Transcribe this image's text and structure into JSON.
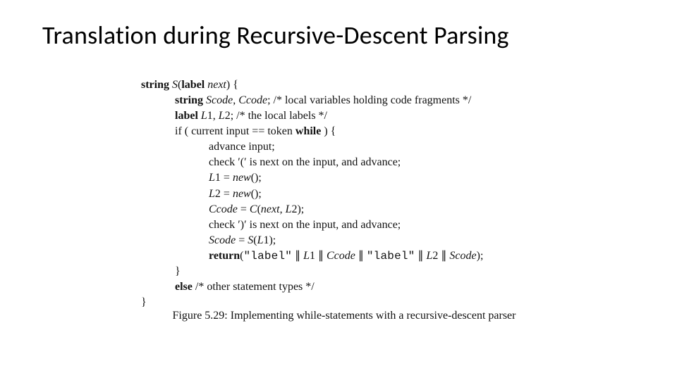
{
  "title": "Translation during Recursive-Descent Parsing",
  "code": {
    "l1_a": "string",
    "l1_b": " S",
    "l1_c": "(",
    "l1_d": "label",
    "l1_e": " next",
    "l1_f": ") {",
    "l2_a": "string",
    "l2_b": " Scode",
    "l2_c": ", ",
    "l2_d": "Ccode",
    "l2_e": "; /* local variables holding code fragments */",
    "l3_a": "label",
    "l3_b": " L",
    "l3_c": "1, ",
    "l3_d": "L",
    "l3_e": "2; /* the local labels */",
    "l4_a": "if ( current input == token ",
    "l4_b": "while",
    "l4_c": " ) {",
    "l5": "advance input;",
    "l6": "check ′(′ is next on the input, and advance;",
    "l7_a": "L",
    "l7_b": "1 = ",
    "l7_c": "new",
    "l7_d": "();",
    "l8_a": "L",
    "l8_b": "2 = ",
    "l8_c": "new",
    "l8_d": "();",
    "l9_a": "Ccode",
    "l9_b": " = ",
    "l9_c": "C",
    "l9_d": "(",
    "l9_e": "next",
    "l9_f": ", ",
    "l9_g": "L",
    "l9_h": "2);",
    "l10": "check ′)′ is next on the input, and advance;",
    "l11_a": "Scode",
    "l11_b": " = ",
    "l11_c": "S",
    "l11_d": "(",
    "l11_e": "L",
    "l11_f": "1);",
    "l12_a": "return",
    "l12_b": "(",
    "l12_c": "\"label\"",
    "l12_d": " ∥ ",
    "l12_e": "L",
    "l12_f": "1 ∥ ",
    "l12_g": "Ccode",
    "l12_h": " ∥ ",
    "l12_i": "\"label\"",
    "l12_j": " ∥ ",
    "l12_k": "L",
    "l12_l": "2 ∥ ",
    "l12_m": "Scode",
    "l12_n": ");",
    "l13": "}",
    "l14_a": "else",
    "l14_b": " /* other statement types */",
    "l15": "}"
  },
  "caption": "Figure 5.29: Implementing while-statements with a recursive-descent parser"
}
